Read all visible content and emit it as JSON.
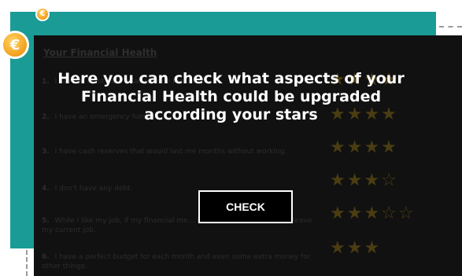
{
  "coins": {
    "small_symbol": "€",
    "big_symbol": "€"
  },
  "panel": {
    "title": "Your Financial Health",
    "questions": [
      {
        "num": "1.",
        "text": "I save at least 10% of all income I receive.",
        "stars": "★★★★"
      },
      {
        "num": "2.",
        "text": "I have an emergency fund.",
        "stars": "★★★★"
      },
      {
        "num": "3.",
        "text": "I have cash reserves that would last me months without working.",
        "stars": "★★★★"
      },
      {
        "num": "4.",
        "text": "I don't have any debt.",
        "stars": "★★★☆"
      },
      {
        "num": "5.",
        "text": "While I like my job, if my financial me... I wasn't interested, I could leave my current job.",
        "stars": "★★★☆☆"
      },
      {
        "num": "6.",
        "text": "I have a perfect budget for each month and even some extra money for other things.",
        "stars": "★★★"
      }
    ]
  },
  "overlay": {
    "line1": "Here you can check what aspects of your",
    "line2": "Financial Health could be upgraded",
    "line3": "according your stars"
  },
  "button": {
    "check_label": "CHECK"
  }
}
